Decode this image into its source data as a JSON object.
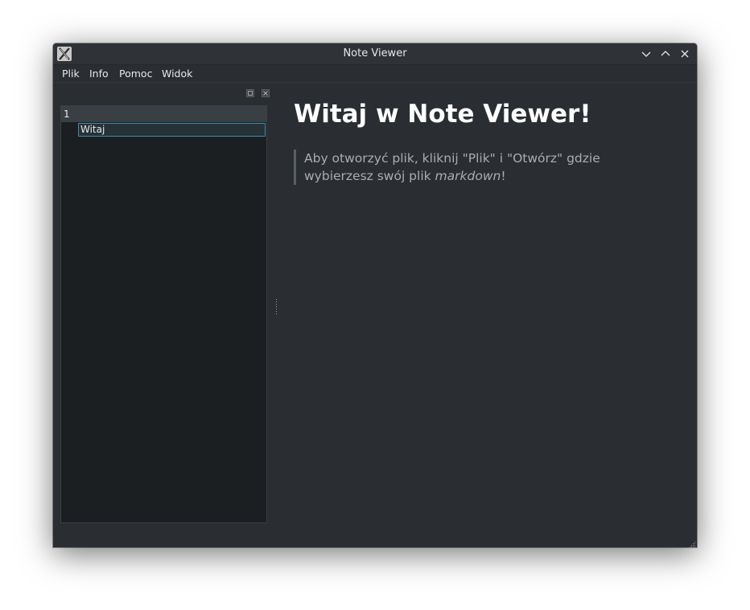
{
  "window": {
    "title": "Note Viewer"
  },
  "menu": {
    "items": [
      "Plik",
      "Info",
      "Pomoc",
      "Widok"
    ]
  },
  "sidebar": {
    "tree": {
      "parent_label": "1",
      "child_label": "Witaj"
    }
  },
  "document": {
    "heading": "Witaj w Note Viewer!",
    "quote_prefix": "Aby otworzyć plik, kliknij \"Plik\" i \"Otwórz\" gdzie wybierzesz swój plik ",
    "quote_emphasis": "markdown",
    "quote_suffix": "!"
  },
  "colors": {
    "window_bg": "#2a2e32",
    "titlebar_bg": "#2f3338",
    "tree_bg": "#1c1f22",
    "selection_border": "#3d8ea7",
    "heading_text": "#ffffff",
    "quote_text": "#a9adb1"
  },
  "icons": {
    "app": "x-window-icon",
    "minimize": "chevron-down-icon",
    "maximize": "chevron-up-icon",
    "close": "close-icon",
    "dock_float": "float-icon",
    "dock_close": "close-icon"
  }
}
